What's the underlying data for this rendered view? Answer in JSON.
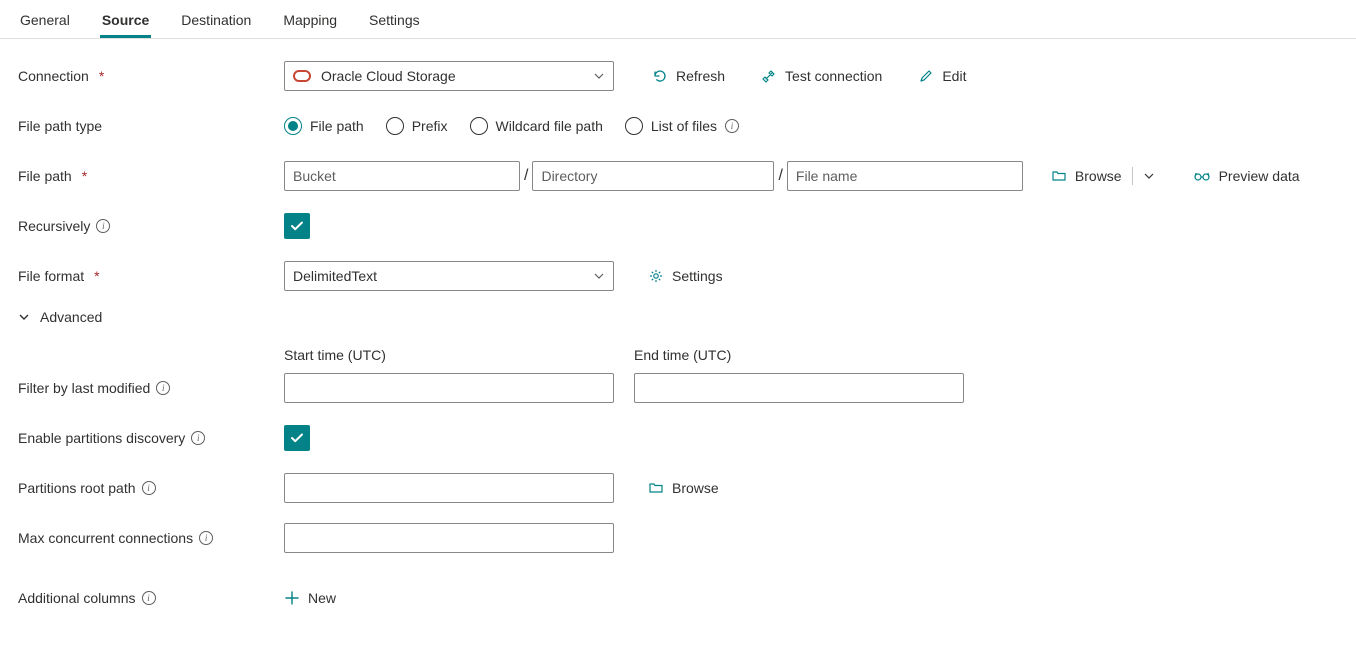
{
  "tabs": {
    "general": "General",
    "source": "Source",
    "destination": "Destination",
    "mapping": "Mapping",
    "settings": "Settings",
    "active": "source"
  },
  "labels": {
    "connection": "Connection",
    "filePathType": "File path type",
    "filePath": "File path",
    "recursively": "Recursively",
    "fileFormat": "File format",
    "advanced": "Advanced",
    "startTime": "Start time (UTC)",
    "endTime": "End time (UTC)",
    "filterByLastModified": "Filter by last modified",
    "enablePartitions": "Enable partitions discovery",
    "partitionsRoot": "Partitions root path",
    "maxConcurrent": "Max concurrent connections",
    "additionalColumns": "Additional columns"
  },
  "connection": {
    "selected": "Oracle Cloud Storage",
    "actions": {
      "refresh": "Refresh",
      "test": "Test connection",
      "edit": "Edit"
    }
  },
  "filePathType": {
    "options": {
      "filePath": "File path",
      "prefix": "Prefix",
      "wildcard": "Wildcard file path",
      "listOfFiles": "List of files"
    },
    "selected": "filePath"
  },
  "filePathInputs": {
    "bucketPlaceholder": "Bucket",
    "dirPlaceholder": "Directory",
    "filePlaceholder": "File name"
  },
  "pathActions": {
    "browse": "Browse",
    "preview": "Preview data"
  },
  "fileFormat": {
    "selected": "DelimitedText",
    "settings": "Settings"
  },
  "partitions": {
    "browse": "Browse"
  },
  "additional": {
    "new": "New"
  }
}
